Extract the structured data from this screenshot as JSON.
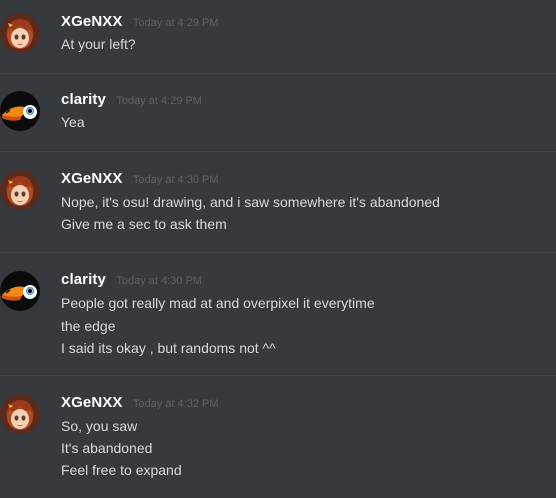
{
  "messages": [
    {
      "author": "XGeNXX",
      "time": "Today at 4:29 PM",
      "avatar": "anime-girl-avatar",
      "lines": [
        "At your left?"
      ]
    },
    {
      "author": "clarity",
      "time": "Today at 4:29 PM",
      "avatar": "toucan-avatar",
      "lines": [
        "Yea"
      ]
    },
    {
      "author": "XGeNXX",
      "time": "Today at 4:30 PM",
      "avatar": "anime-girl-avatar",
      "lines": [
        "Nope, it's osu! drawing, and i saw somewhere it's abandoned",
        "Give me a sec to ask them"
      ]
    },
    {
      "author": "clarity",
      "time": "Today at 4:30 PM",
      "avatar": "toucan-avatar",
      "lines": [
        "People got really mad at and overpixel it everytime",
        "the edge",
        "I said its okay , but randoms not ^^"
      ]
    },
    {
      "author": "XGeNXX",
      "time": "Today at 4:32 PM",
      "avatar": "anime-girl-avatar",
      "lines": [
        "So, you saw",
        "It's abandoned",
        "Feel free to expand"
      ]
    }
  ],
  "colors": {
    "background": "#36393e",
    "username": "#ffffff",
    "timestamp": "#5e6166",
    "message_text": "#d7d9da",
    "divider": "#40434a"
  }
}
